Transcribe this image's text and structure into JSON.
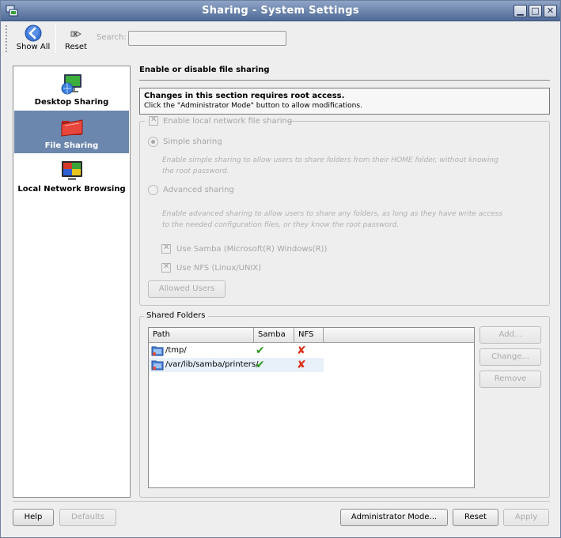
{
  "window": {
    "title": "Sharing - System Settings",
    "controls": [
      "minimize",
      "maximize",
      "close"
    ]
  },
  "toolbar": {
    "show_all": "Show All",
    "reset": "Reset",
    "search_label": "Search:",
    "search_value": ""
  },
  "sidebar": {
    "items": [
      {
        "label": "Desktop Sharing",
        "icon": "desktop-sharing-icon",
        "selected": false
      },
      {
        "label": "File Sharing",
        "icon": "folder-sharing-icon",
        "selected": true
      },
      {
        "label": "Local Network Browsing",
        "icon": "network-browsing-icon",
        "selected": false
      }
    ]
  },
  "main": {
    "heading": "Enable or disable file sharing",
    "notice_bold": "Changes in this section requires root access.",
    "notice_text": "Click the \"Administrator Mode\" button to allow modifications.",
    "enable_local": "Enable local network file sharing",
    "simple_sharing": "Simple sharing",
    "simple_desc_1": "Enable simple sharing to allow users to share folders from their HOME folder, without knowing",
    "simple_desc_2": "the root password.",
    "advanced_sharing": "Advanced sharing",
    "advanced_desc_1": "Enable advanced sharing to allow users to share any folders, as long as they have write access",
    "advanced_desc_2": "to the needed configuration files, or they know the root password.",
    "use_samba": "Use Samba (Microsoft(R) Windows(R))",
    "use_nfs": "Use NFS (Linux/UNIX)",
    "allowed_users": "Allowed Users"
  },
  "shared_folders": {
    "title": "Shared Folders",
    "columns": [
      "Path",
      "Samba",
      "NFS"
    ],
    "rows": [
      {
        "path": "/tmp/",
        "samba": true,
        "nfs": false
      },
      {
        "path": "/var/lib/samba/printers/",
        "samba": true,
        "nfs": false
      }
    ],
    "add": "Add...",
    "change": "Change...",
    "remove": "Remove"
  },
  "footer": {
    "help": "Help",
    "defaults": "Defaults",
    "admin_mode": "Administrator Mode...",
    "reset": "Reset",
    "apply": "Apply"
  },
  "colors": {
    "titlebar": "#5d77a3",
    "selection": "#6c87ad",
    "check_yes": "#2b9b1f",
    "check_no": "#d8341c"
  }
}
